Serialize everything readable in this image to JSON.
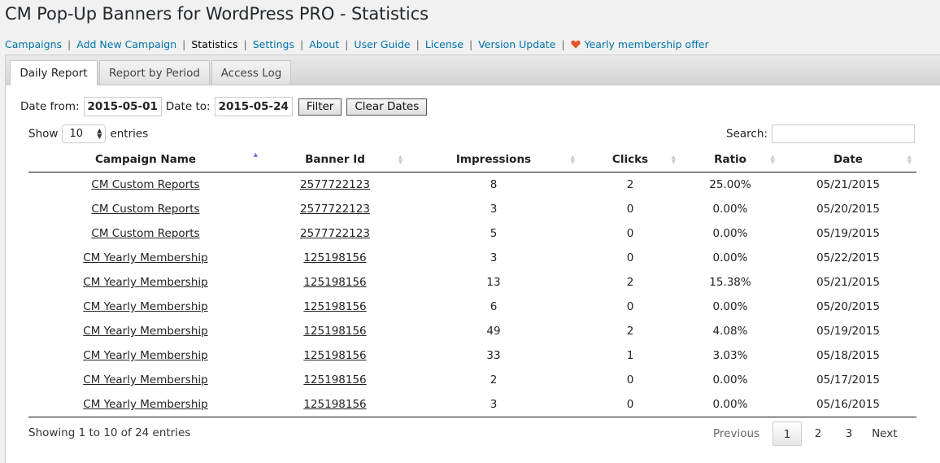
{
  "page": {
    "title": "CM Pop-Up Banners for WordPress PRO - Statistics"
  },
  "subnav": {
    "items": [
      "Campaigns",
      "Add New Campaign",
      "Statistics",
      "Settings",
      "About",
      "User Guide",
      "License",
      "Version Update"
    ],
    "current": "Statistics",
    "offer": "Yearly membership offer",
    "offer_icon": "heart-icon"
  },
  "tabs": [
    "Daily Report",
    "Report by Period",
    "Access Log"
  ],
  "active_tab": "Daily Report",
  "filter": {
    "from_label": "Date from:",
    "from_value": "2015-05-01",
    "to_label": "Date to:",
    "to_value": "2015-05-24",
    "filter_button": "Filter",
    "clear_button": "Clear Dates"
  },
  "length": {
    "show_label": "Show",
    "value": "10",
    "entries_label": "entries"
  },
  "search": {
    "label": "Search:",
    "value": ""
  },
  "table": {
    "columns": [
      "Campaign Name",
      "Banner Id",
      "Impressions",
      "Clicks",
      "Ratio",
      "Date"
    ],
    "sorted_column": "Campaign Name",
    "rows": [
      [
        "CM Custom Reports",
        "2577722123",
        "8",
        "2",
        "25.00%",
        "05/21/2015"
      ],
      [
        "CM Custom Reports",
        "2577722123",
        "3",
        "0",
        "0.00%",
        "05/20/2015"
      ],
      [
        "CM Custom Reports",
        "2577722123",
        "5",
        "0",
        "0.00%",
        "05/19/2015"
      ],
      [
        "CM Yearly Membership",
        "125198156",
        "3",
        "0",
        "0.00%",
        "05/22/2015"
      ],
      [
        "CM Yearly Membership",
        "125198156",
        "13",
        "2",
        "15.38%",
        "05/21/2015"
      ],
      [
        "CM Yearly Membership",
        "125198156",
        "6",
        "0",
        "0.00%",
        "05/20/2015"
      ],
      [
        "CM Yearly Membership",
        "125198156",
        "49",
        "2",
        "4.08%",
        "05/19/2015"
      ],
      [
        "CM Yearly Membership",
        "125198156",
        "33",
        "1",
        "3.03%",
        "05/18/2015"
      ],
      [
        "CM Yearly Membership",
        "125198156",
        "2",
        "0",
        "0.00%",
        "05/17/2015"
      ],
      [
        "CM Yearly Membership",
        "125198156",
        "3",
        "0",
        "0.00%",
        "05/16/2015"
      ]
    ]
  },
  "info": "Showing 1 to 10 of 24 entries",
  "pagination": {
    "previous": "Previous",
    "pages": [
      "1",
      "2",
      "3"
    ],
    "current": "1",
    "next": "Next"
  },
  "colors": {
    "link": "#0073aa",
    "heart": "#e2572b",
    "sort_active": "#6b7dd6"
  }
}
